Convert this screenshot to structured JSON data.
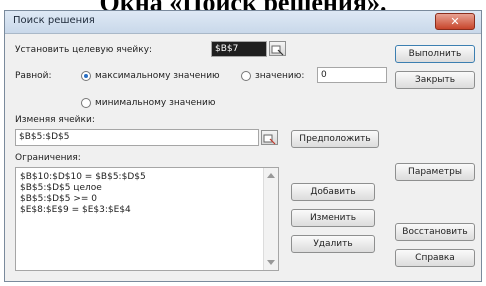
{
  "caption": "Окна «Поиск решения».",
  "dialog": {
    "title": "Поиск решения",
    "close_label": "✕",
    "target_cell": {
      "label": "Установить целевую ячейку:",
      "value": "$B$7"
    },
    "equal_to": {
      "label": "Равной:",
      "option_max": "максимальному значению",
      "option_value": "значению:",
      "value": "0",
      "option_min": "минимальному значению"
    },
    "changing_cells": {
      "label": "Изменяя ячейки:",
      "value": "$B$5:$D$5"
    },
    "guess_button": "Предположить",
    "constraints": {
      "label": "Ограничения:",
      "items": [
        "$B$10:$D$10 = $B$5:$D$5",
        "$B$5:$D$5    целое",
        "$B$5:$D$5 >= 0",
        "$E$8:$E$9 = $E$3:$E$4"
      ]
    },
    "add_button": "Добавить",
    "change_button": "Изменить",
    "delete_button": "Удалить",
    "run_button": "Выполнить",
    "close_button": "Закрыть",
    "options_button": "Параметры",
    "reset_button": "Восстановить",
    "help_button": "Справка"
  }
}
